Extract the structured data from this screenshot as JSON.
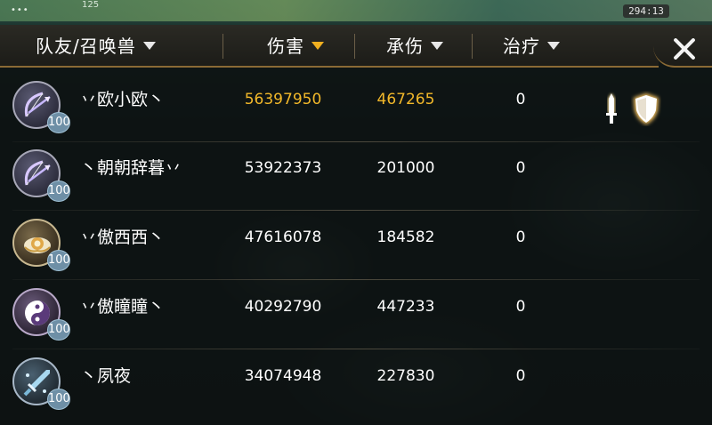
{
  "hud": {
    "top_number": "125",
    "timer": "294:13"
  },
  "header": {
    "col_team": "队友/召唤兽",
    "col_damage": "伤害",
    "col_taken": "承伤",
    "col_heal": "治疗",
    "active_sort": "伤害"
  },
  "colors": {
    "gold": "#f2b82a",
    "header_border": "#8a6a35",
    "level_badge": "#6e8fa6"
  },
  "players": [
    {
      "name": "丷欧小欧丶",
      "level": "100",
      "damage": "56397950",
      "taken": "467265",
      "heal": "0",
      "icon": "bow-icon",
      "highlight": true
    },
    {
      "name": "丶朝朝辞暮丷",
      "level": "100",
      "damage": "53922373",
      "taken": "201000",
      "heal": "0",
      "icon": "bow-icon",
      "highlight": false
    },
    {
      "name": "丷傲西西丶",
      "level": "100",
      "damage": "47616078",
      "taken": "184582",
      "heal": "0",
      "icon": "cloud-icon",
      "highlight": false
    },
    {
      "name": "丷傲瞳瞳丶",
      "level": "100",
      "damage": "40292790",
      "taken": "447233",
      "heal": "0",
      "icon": "yin-yang-icon",
      "highlight": false
    },
    {
      "name": "丶夙夜",
      "level": "100",
      "damage": "34074948",
      "taken": "227830",
      "heal": "0",
      "icon": "sword-icon",
      "highlight": false
    }
  ],
  "mvp_badges": [
    "top-damage-sword-icon",
    "top-tank-shield-icon"
  ]
}
